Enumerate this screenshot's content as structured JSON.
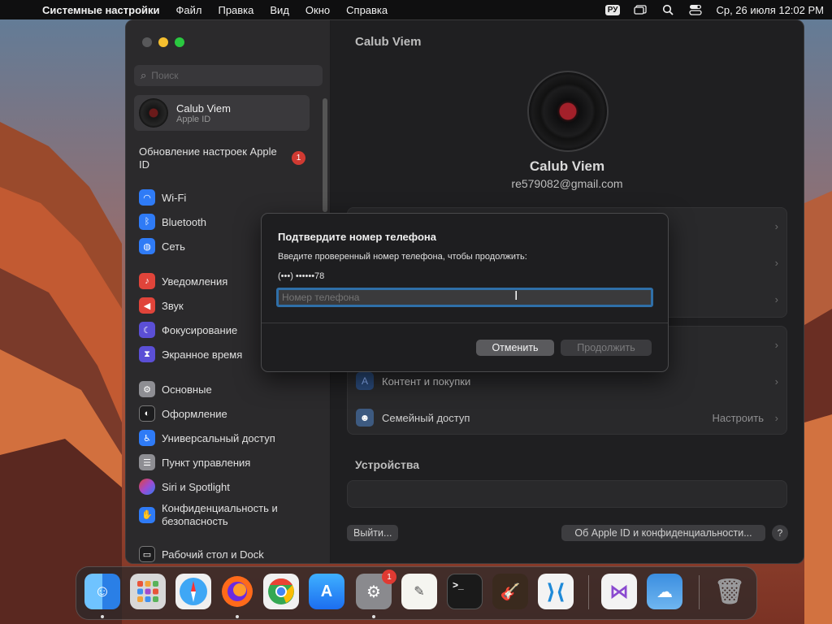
{
  "menubar": {
    "app": "Системные настройки",
    "menus": [
      "Файл",
      "Правка",
      "Вид",
      "Окно",
      "Справка"
    ],
    "input_lang": "РУ",
    "datetime": "Ср, 26 июля  12:02 PM"
  },
  "sidebar": {
    "search_placeholder": "Поиск",
    "account": {
      "name": "Calub Viem",
      "sub": "Apple ID"
    },
    "update": {
      "label": "Обновление настроек Apple ID",
      "badge": "1"
    },
    "items": [
      {
        "label": "Wi-Fi",
        "icon": "wifi-icon",
        "color": "#2f7bf6"
      },
      {
        "label": "Bluetooth",
        "icon": "bluetooth-icon",
        "color": "#2f7bf6"
      },
      {
        "label": "Сеть",
        "icon": "globe-icon",
        "color": "#2f7bf6"
      },
      {
        "label": "Уведомления",
        "icon": "bell-icon",
        "color": "#e0443a"
      },
      {
        "label": "Звук",
        "icon": "speaker-icon",
        "color": "#e0443a"
      },
      {
        "label": "Фокусирование",
        "icon": "moon-icon",
        "color": "#5b4fd6"
      },
      {
        "label": "Экранное время",
        "icon": "hourglass-icon",
        "color": "#5b4fd6"
      },
      {
        "label": "Основные",
        "icon": "gear-icon",
        "color": "#8e8e93"
      },
      {
        "label": "Оформление",
        "icon": "appearance-icon",
        "color": "#1c1c1e"
      },
      {
        "label": "Универсальный доступ",
        "icon": "accessibility-icon",
        "color": "#2f7bf6"
      },
      {
        "label": "Пункт управления",
        "icon": "control-center-icon",
        "color": "#8e8e93"
      },
      {
        "label": "Siri и Spotlight",
        "icon": "siri-icon",
        "color": "#a04ad0"
      },
      {
        "label": "Конфиденциальность и безопасность",
        "icon": "hand-icon",
        "color": "#2f7bf6"
      },
      {
        "label": "Рабочий стол и Dock",
        "icon": "desktop-icon",
        "color": "#1c1c1e"
      }
    ]
  },
  "main": {
    "title": "Calub Viem",
    "profile_name": "Calub Viem",
    "profile_email": "re579082@gmail.com",
    "rows": [
      {
        "label": "Контент и покупки",
        "icon": "appstore-icon",
        "value": ""
      },
      {
        "label": "Семейный доступ",
        "icon": "family-icon",
        "value": "Настроить"
      }
    ],
    "devices_title": "Устройства",
    "signout_label": "Выйти...",
    "about_label": "Об Apple ID и конфиденциальности...",
    "help_label": "?"
  },
  "dialog": {
    "title": "Подтвердите номер телефона",
    "description": "Введите проверенный номер телефона, чтобы продолжить:",
    "masked_phone": "(•••) ••••••78",
    "input_placeholder": "Номер телефона",
    "cancel_label": "Отменить",
    "continue_label": "Продолжить"
  },
  "dock": {
    "apps": [
      {
        "name": "finder-icon",
        "color": "#3d8ff0"
      },
      {
        "name": "launchpad-icon",
        "color": "#d8d8d8"
      },
      {
        "name": "safari-icon",
        "color": "#3fa7f5"
      },
      {
        "name": "firefox-icon",
        "color": "#ff6a1a"
      },
      {
        "name": "chrome-icon",
        "color": "#f1f1f1"
      },
      {
        "name": "appstore-icon",
        "color": "#1c8ef5"
      },
      {
        "name": "system-settings-icon",
        "color": "#8a8a8e",
        "badge": "1"
      },
      {
        "name": "textedit-icon",
        "color": "#f5f5f0"
      },
      {
        "name": "terminal-icon",
        "color": "#1a1a1a"
      },
      {
        "name": "garageband-icon",
        "color": "#3a2a1e"
      },
      {
        "name": "vscode-icon",
        "color": "#1f8ad8"
      },
      {
        "name": "visual-studio-icon",
        "color": "#f3f3f3"
      },
      {
        "name": "weather-icon",
        "color": "#3b8ee0"
      },
      {
        "name": "trash-icon",
        "color": "#7a7a7c"
      }
    ]
  }
}
